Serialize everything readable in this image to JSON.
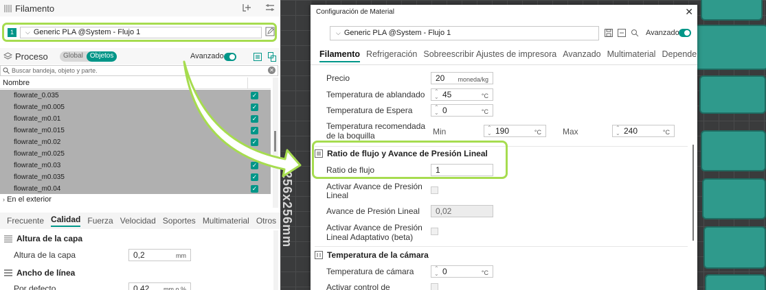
{
  "left": {
    "filament_title": "Filamento",
    "filament_slot": "1",
    "filament_preset": "Generic PLA @System - Flujo 1",
    "process_title": "Proceso",
    "toggle_global": "Global",
    "toggle_objects": "Objetos",
    "advanced_label": "Avanzado",
    "search_placeholder": "Buscar bandeja, objeto y parte.",
    "name_header": "Nombre",
    "objects": [
      "flowrate_0.035",
      "flowrate_m0.005",
      "flowrate_m0.01",
      "flowrate_m0.015",
      "flowrate_m0.02",
      "flowrate_m0.025",
      "flowrate_m0.03",
      "flowrate_m0.035",
      "flowrate_m0.04"
    ],
    "outside": "En el exterior",
    "tabs": [
      "Frecuente",
      "Calidad",
      "Fuerza",
      "Velocidad",
      "Soportes",
      "Multimaterial",
      "Otros"
    ],
    "active_tab": "Calidad",
    "group_layer": "Altura de la capa",
    "opt_layer_height": "Altura de la capa",
    "val_layer_height": "0,2",
    "unit_mm": "mm",
    "group_line_width": "Ancho de línea",
    "opt_default": "Por defecto",
    "val_default": "0,42",
    "unit_default": "mm o %"
  },
  "background": {
    "bed_label": "256x256mm"
  },
  "dialog": {
    "title": "Configuración de Material",
    "preset": "Generic PLA @System - Flujo 1",
    "advanced_label": "Avanzado",
    "tabs": [
      "Filamento",
      "Refrigeración",
      "Sobreescribir Ajustes de impresora",
      "Avanzado",
      "Multimaterial",
      "Dependenc..."
    ],
    "active_tab": "Filamento",
    "price_label": "Precio",
    "price_value": "20",
    "price_unit": "moneda/kg",
    "soften_label": "Temperatura de ablandado",
    "soften_value": "45",
    "unit_c": "°C",
    "standby_label": "Temperatura de Espera",
    "standby_value": "0",
    "nozzle_label_1": "Temperatura recomendada",
    "nozzle_label_2": "de la boquilla",
    "min_label": "Min",
    "min_value": "190",
    "max_label": "Max",
    "max_value": "240",
    "group_flow": "Ratio de flujo y Avance de Presión Lineal",
    "flow_label": "Ratio de flujo",
    "flow_value": "1",
    "pa_enable_1": "Activar Avance de Presión",
    "pa_enable_2": "Lineal",
    "pa_label": "Avance de Presión Lineal",
    "pa_value": "0,02",
    "apa_label_1": "Activar Avance de Presión",
    "apa_label_2": "Lineal Adaptativo (beta)",
    "group_chamber": "Temperatura de la cámara",
    "chamber_label": "Temperatura de cámara",
    "chamber_value": "0",
    "chamber_ctrl_label": "Activar control de"
  },
  "colors": {
    "accent": "#009688",
    "highlight": "#a6dc4f"
  }
}
